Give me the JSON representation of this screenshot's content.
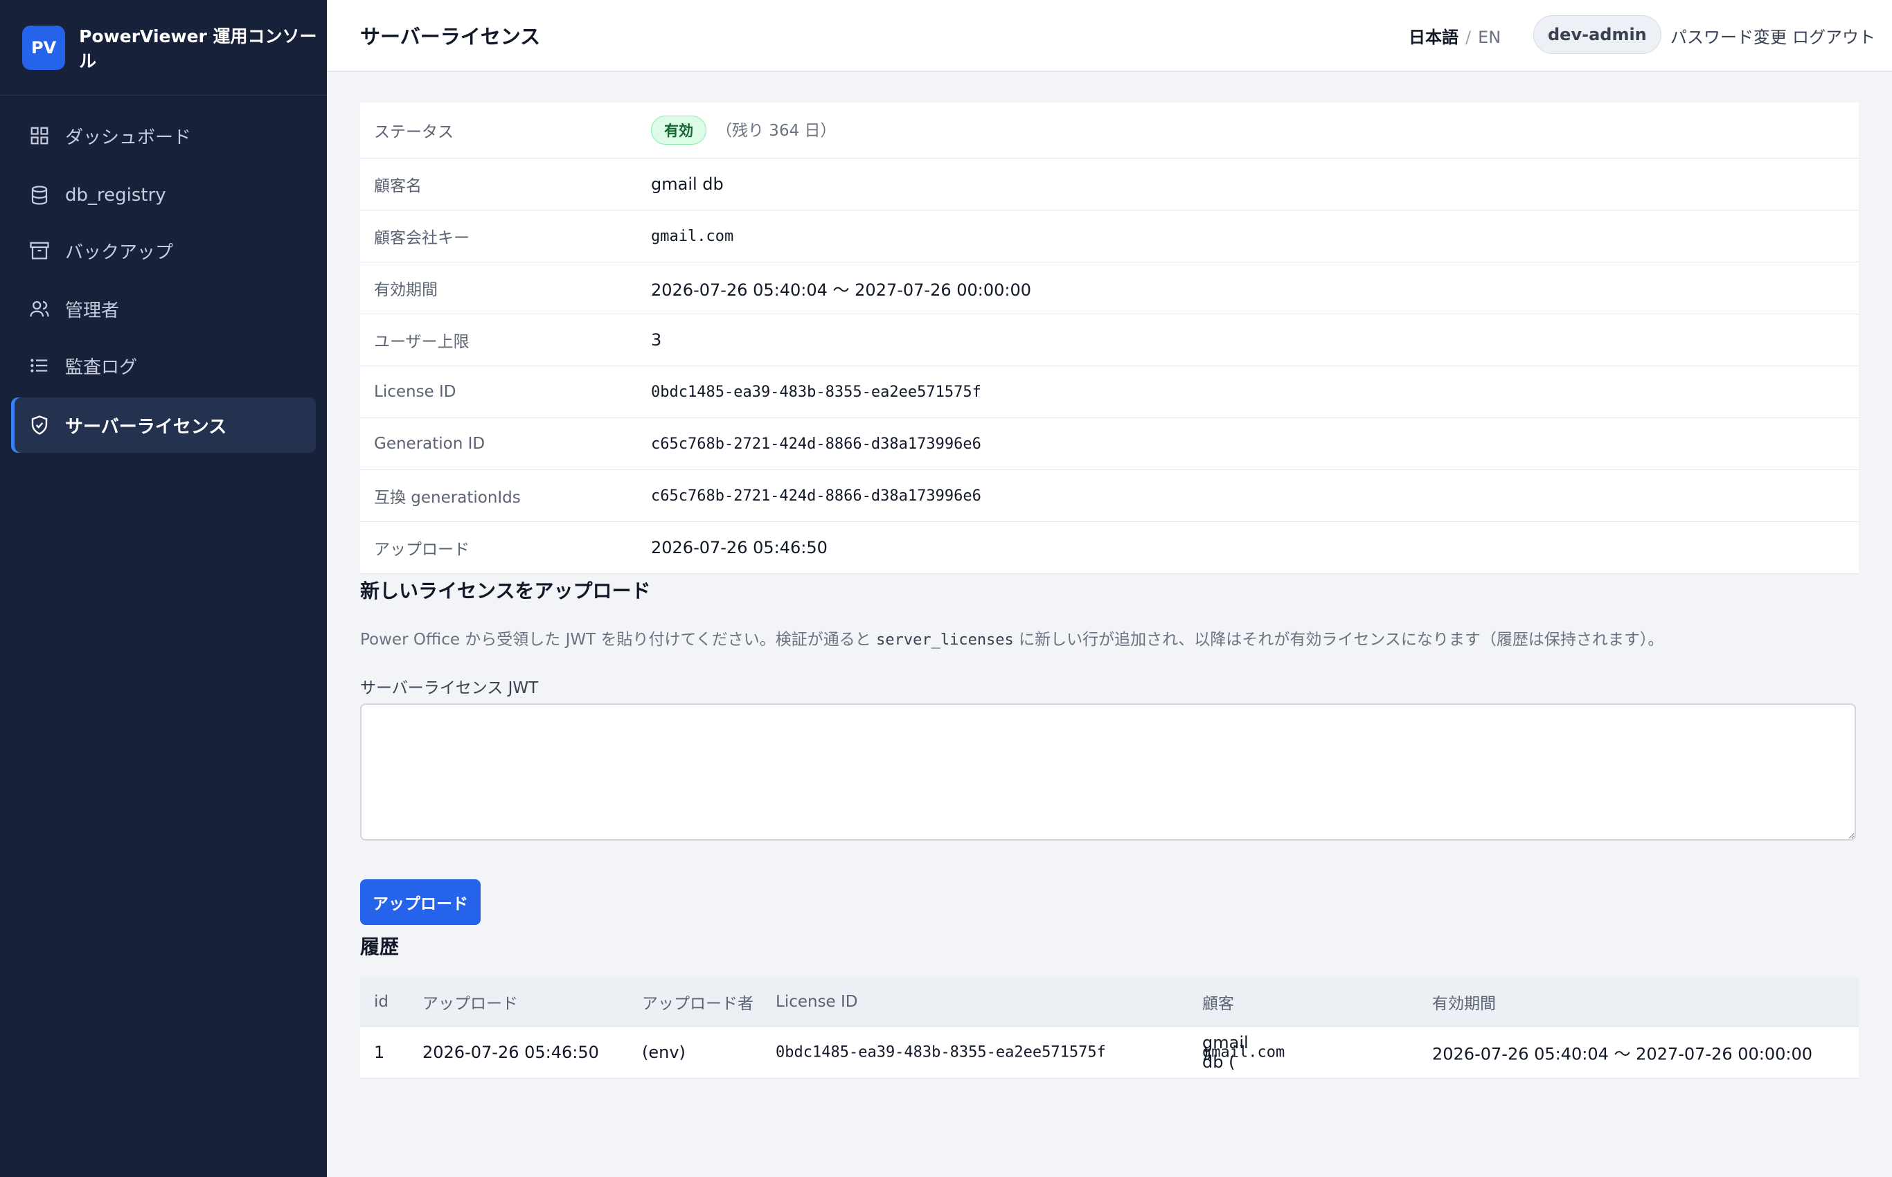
{
  "brand": {
    "logo": "PV",
    "name": "PowerViewer 運用コンソール"
  },
  "sidebar": {
    "items": [
      {
        "label": "ダッシュボード",
        "icon": "grid-icon"
      },
      {
        "label": "db_registry",
        "icon": "database-icon"
      },
      {
        "label": "バックアップ",
        "icon": "archive-icon"
      },
      {
        "label": "管理者",
        "icon": "users-icon"
      },
      {
        "label": "監査ログ",
        "icon": "list-icon"
      },
      {
        "label": "サーバーライセンス",
        "icon": "shield-check-icon",
        "active": true
      }
    ]
  },
  "header": {
    "title": "サーバーライセンス",
    "lang_ja": "日本語",
    "lang_sep": "/",
    "lang_en": "EN",
    "user": "dev-admin",
    "change_password": "パスワード変更",
    "logout": "ログアウト"
  },
  "license": {
    "status_label": "ステータス",
    "status_value": "有効",
    "status_remaining": "（残り 364 日）",
    "customer_name_label": "顧客名",
    "customer_name": "gmail db",
    "company_key_label": "顧客会社キー",
    "company_key": "gmail.com",
    "validity_label": "有効期間",
    "validity": "2026-07-26 05:40:04 〜 2027-07-26 00:00:00",
    "user_limit_label": "ユーザー上限",
    "user_limit": "3",
    "license_id_label": "License ID",
    "license_id": "0bdc1485-ea39-483b-8355-ea2ee571575f",
    "generation_id_label": "Generation ID",
    "generation_id": "c65c768b-2721-424d-8866-d38a173996e6",
    "compat_label": "互換 generationIds",
    "compat": "c65c768b-2721-424d-8866-d38a173996e6",
    "upload_label": "アップロード",
    "upload_at": "2026-07-26 05:46:50"
  },
  "upload_section": {
    "title": "新しいライセンスをアップロード",
    "desc_pre": "Power Office から受領した JWT を貼り付けてください。検証が通ると ",
    "desc_code": "server_licenses",
    "desc_post": " に新しい行が追加され、以降はそれが有効ライセンスになります（履歴は保持されます）。",
    "field_label": "サーバーライセンス JWT",
    "jwt_placeholder": "",
    "button": "アップロード"
  },
  "history": {
    "title": "履歴",
    "columns": [
      "id",
      "アップロード",
      "アップロード者",
      "License ID",
      "顧客",
      "有効期間"
    ],
    "rows": [
      {
        "id": "1",
        "uploaded": "2026-07-26 05:46:50",
        "uploader": "(env)",
        "license_id": "0bdc1485-ea39-483b-8355-ea2ee571575f",
        "customer": "gmail db (",
        "customer_key": "gmail.com",
        "customer_close": ")",
        "validity": "2026-07-26 05:40:04 〜 2027-07-26 00:00:00"
      }
    ]
  }
}
